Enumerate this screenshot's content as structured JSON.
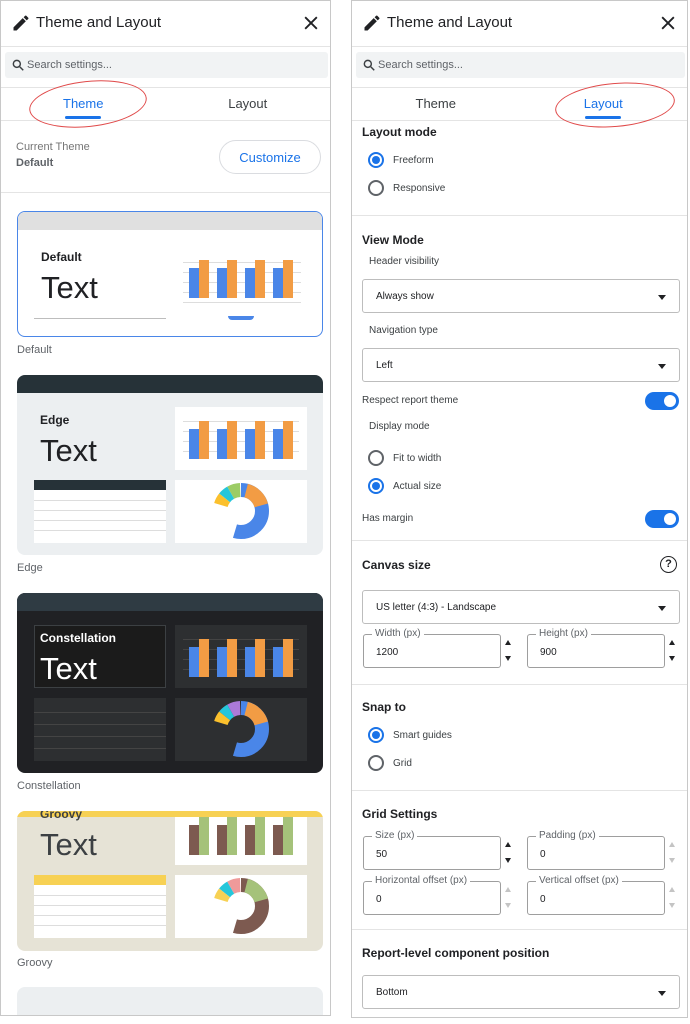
{
  "left": {
    "title": "Theme and Layout",
    "search_placeholder": "Search settings...",
    "tabs": [
      "Theme",
      "Layout"
    ],
    "current_theme_label": "Current Theme",
    "current_theme_value": "Default",
    "customize_label": "Customize",
    "cards": [
      {
        "name": "Default",
        "sample": "Text",
        "label": "Default"
      },
      {
        "name": "Edge",
        "sample": "Text",
        "label": "Edge"
      },
      {
        "name": "Constellation",
        "sample": "Text",
        "label": "Constellation"
      },
      {
        "name": "Groovy",
        "sample": "Text",
        "label": "Groovy"
      }
    ]
  },
  "right": {
    "title": "Theme and Layout",
    "search_placeholder": "Search settings...",
    "tabs": [
      "Theme",
      "Layout"
    ],
    "layout_mode": {
      "title": "Layout mode",
      "options": [
        "Freeform",
        "Responsive"
      ],
      "selected": "Freeform"
    },
    "view_mode": {
      "title": "View Mode",
      "header_visibility_label": "Header visibility",
      "header_visibility_value": "Always show",
      "navigation_type_label": "Navigation type",
      "navigation_type_value": "Left",
      "respect_theme_label": "Respect report theme",
      "display_mode_label": "Display mode",
      "display_options": [
        "Fit to width",
        "Actual size"
      ],
      "display_selected": "Actual size",
      "has_margin_label": "Has margin"
    },
    "canvas": {
      "title": "Canvas size",
      "help": "?",
      "size_value": "US letter (4:3) - Landscape",
      "width_label": "Width (px)",
      "width_value": "1200",
      "height_label": "Height (px)",
      "height_value": "900"
    },
    "snap": {
      "title": "Snap to",
      "options": [
        "Smart guides",
        "Grid"
      ],
      "selected": "Smart guides"
    },
    "grid": {
      "title": "Grid Settings",
      "size_label": "Size (px)",
      "size_value": "50",
      "padding_label": "Padding (px)",
      "padding_value": "0",
      "hoff_label": "Horizontal offset (px)",
      "hoff_value": "0",
      "voff_label": "Vertical offset (px)",
      "voff_value": "0"
    },
    "component_position": {
      "title": "Report-level component position",
      "value": "Bottom"
    }
  },
  "colors": {
    "accent": "#1a73e8",
    "annotation": "#e04a4a",
    "orange": "#f29c44",
    "blue": "#4a86e8"
  }
}
